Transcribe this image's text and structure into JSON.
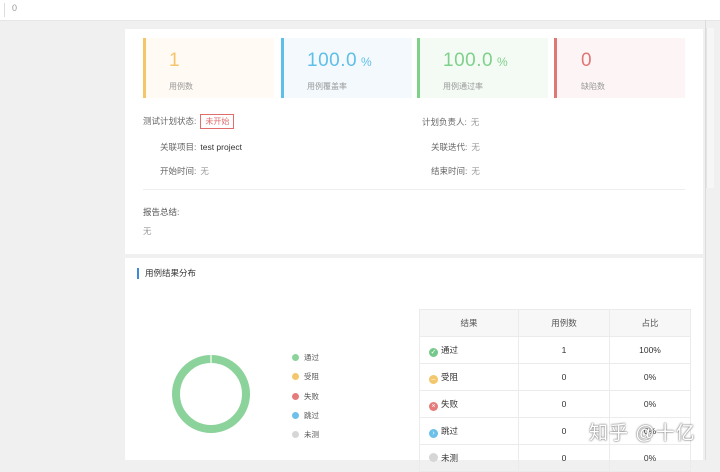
{
  "topbar": {
    "text": "0"
  },
  "stats": [
    {
      "value": "1",
      "unit": "",
      "label": "用例数",
      "color": "#f5c56b"
    },
    {
      "value": "100.0",
      "unit": "%",
      "label": "用例覆盖率",
      "color": "#5fbfe8"
    },
    {
      "value": "100.0",
      "unit": "%",
      "label": "用例通过率",
      "color": "#7fd08a"
    },
    {
      "value": "0",
      "unit": "",
      "label": "缺陷数",
      "color": "#e07676"
    }
  ],
  "plan": {
    "status_label": "测试计划状态:",
    "status_value": "未开始",
    "owner_label": "计划负责人:",
    "owner_value": "无",
    "project_label": "关联项目:",
    "project_value": "test project",
    "iteration_label": "关联迭代:",
    "iteration_value": "无",
    "start_label": "开始时间:",
    "start_value": "无",
    "end_label": "结束时间:",
    "end_value": "无",
    "summary_label": "报告总结:",
    "summary_value": "无"
  },
  "distribution": {
    "title": "用例结果分布",
    "legend": [
      {
        "label": "通过",
        "color": "#8bd39a"
      },
      {
        "label": "受阻",
        "color": "#f3c76b"
      },
      {
        "label": "失败",
        "color": "#e57c7c"
      },
      {
        "label": "跳过",
        "color": "#6cc0ea"
      },
      {
        "label": "未测",
        "color": "#d6d6d6"
      }
    ],
    "table": {
      "headers": [
        "结果",
        "用例数",
        "占比"
      ],
      "rows": [
        {
          "result": "通过",
          "count": "1",
          "ratio": "100%",
          "icon": "check-icon",
          "color": "#74c98a"
        },
        {
          "result": "受阻",
          "count": "0",
          "ratio": "0%",
          "icon": "minus-icon",
          "color": "#f3c76b"
        },
        {
          "result": "失败",
          "count": "0",
          "ratio": "0%",
          "icon": "cross-icon",
          "color": "#e57c7c"
        },
        {
          "result": "跳过",
          "count": "0",
          "ratio": "0%",
          "icon": "arrow-right-icon",
          "color": "#6cc0ea"
        },
        {
          "result": "未测",
          "count": "0",
          "ratio": "0%",
          "icon": "circle-icon",
          "color": "#d6d6d6"
        }
      ]
    }
  },
  "watermark": "知乎 @十亿"
}
